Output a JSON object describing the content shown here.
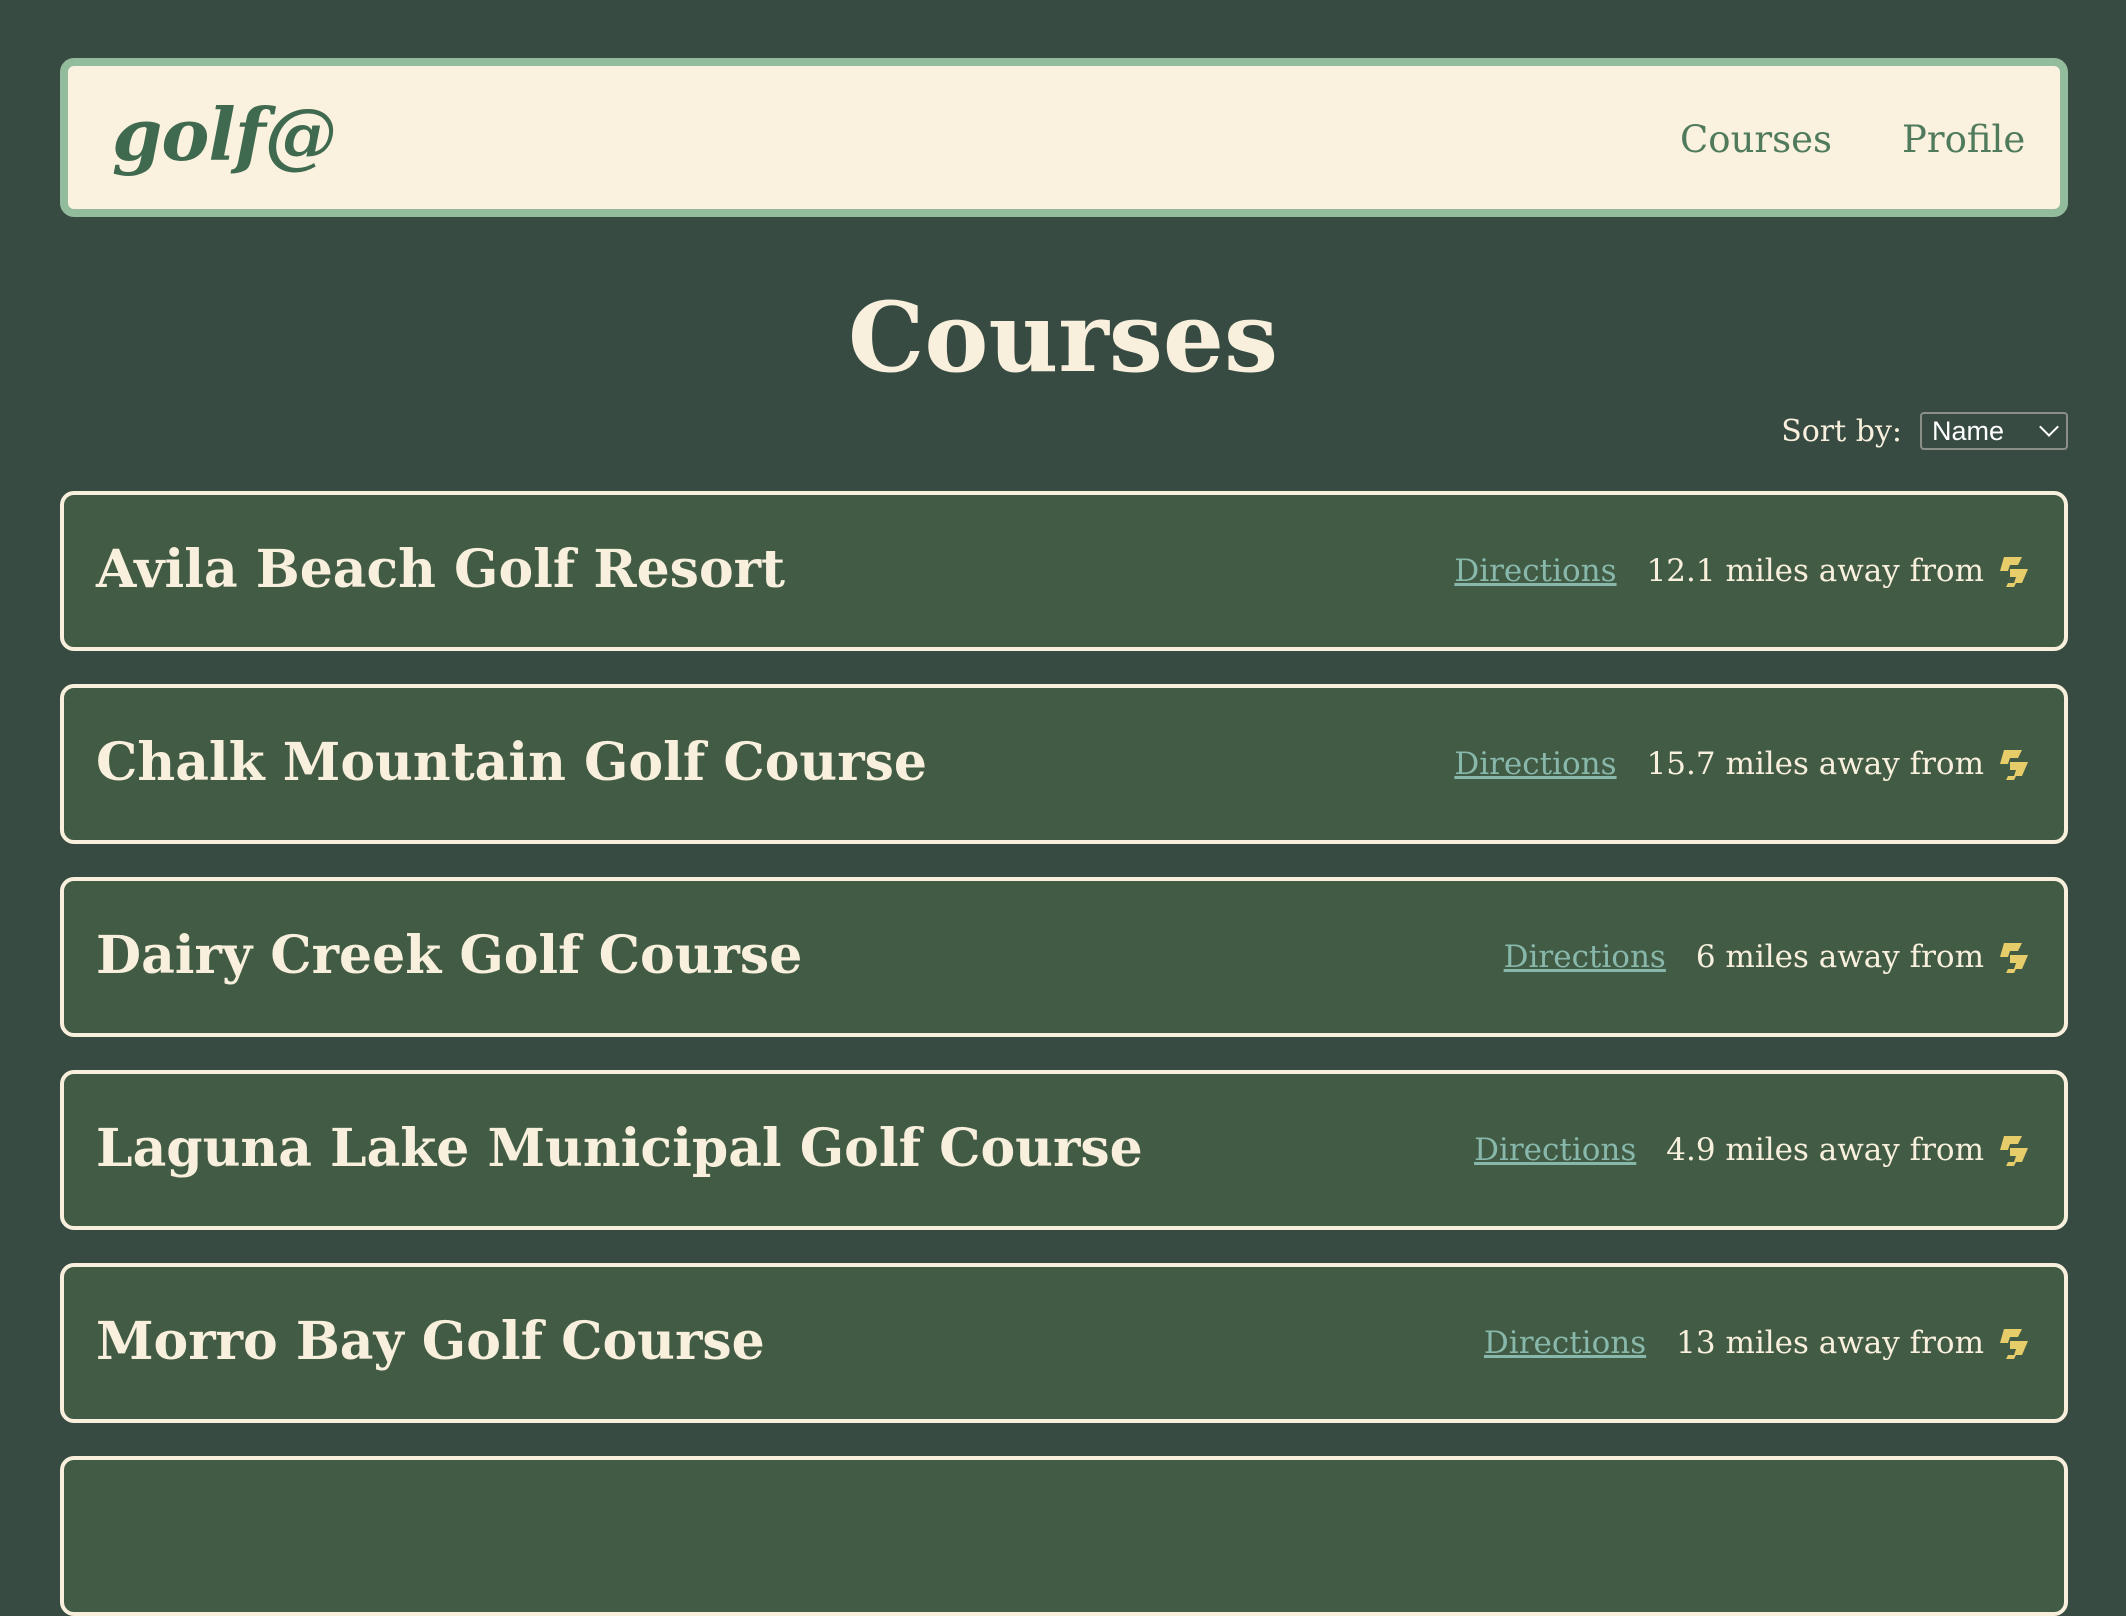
{
  "navbar": {
    "logo": "golf@",
    "links": [
      "Courses",
      "Profile"
    ]
  },
  "page": {
    "title": "Courses"
  },
  "sort": {
    "label": "Sort by:",
    "selected": "Name"
  },
  "courses": [
    {
      "name": "Avila Beach Golf Resort",
      "directions_label": "Directions",
      "distance": "12.1 miles away from"
    },
    {
      "name": "Chalk Mountain Golf Course",
      "directions_label": "Directions",
      "distance": "15.7 miles away from"
    },
    {
      "name": "Dairy Creek Golf Course",
      "directions_label": "Directions",
      "distance": "6 miles away from"
    },
    {
      "name": "Laguna Lake Municipal Golf Course",
      "directions_label": "Directions",
      "distance": "4.9 miles away from"
    },
    {
      "name": "Morro Bay Golf Course",
      "directions_label": "Directions",
      "distance": "13 miles away from"
    }
  ],
  "icons": {
    "distance_from": "cal-poly-logo-icon"
  },
  "colors": {
    "background": "#374b43",
    "card": "#425b45",
    "cream": "#f8f0dc",
    "navbar_border": "#93bc9c",
    "link": "#88b8ab",
    "logo_gold": "#e7cc6a"
  }
}
